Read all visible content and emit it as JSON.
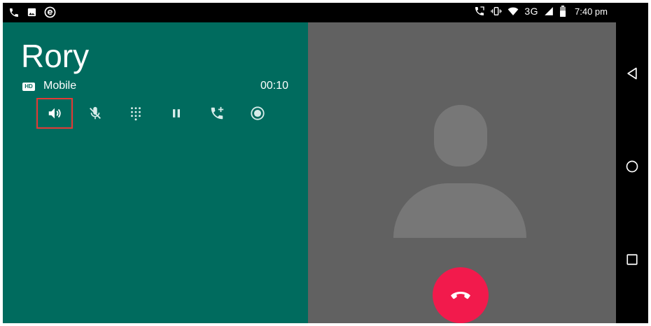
{
  "status_bar": {
    "network": "3G",
    "time": "7:40 pm",
    "left_icons": [
      "phone-icon",
      "image-icon",
      "e-icon"
    ],
    "right_icons": [
      "call-forward-icon",
      "vibrate-icon",
      "wifi-icon",
      "signal-icon",
      "battery-icon"
    ]
  },
  "call": {
    "contact_name": "Rory",
    "hd_badge": "HD",
    "call_type": "Mobile",
    "timer": "00:10",
    "controls": [
      {
        "name": "speaker",
        "icon": "speaker-icon",
        "active": true
      },
      {
        "name": "mute",
        "icon": "mic-off-icon",
        "active": false
      },
      {
        "name": "dialpad",
        "icon": "dialpad-icon",
        "active": false
      },
      {
        "name": "hold",
        "icon": "pause-icon",
        "active": false
      },
      {
        "name": "add-call",
        "icon": "add-call-icon",
        "active": false
      },
      {
        "name": "record",
        "icon": "record-icon",
        "active": false
      }
    ]
  },
  "photo": {
    "placeholder": "avatar-placeholder-icon"
  },
  "end_call": {
    "icon": "end-call-icon"
  },
  "nav_bar": {
    "buttons": [
      "back-icon",
      "home-icon",
      "recents-icon"
    ]
  },
  "colors": {
    "call_panel": "#006b5e",
    "photo_panel": "#616161",
    "end_call": "#f21a4c",
    "highlight": "#e53935"
  }
}
